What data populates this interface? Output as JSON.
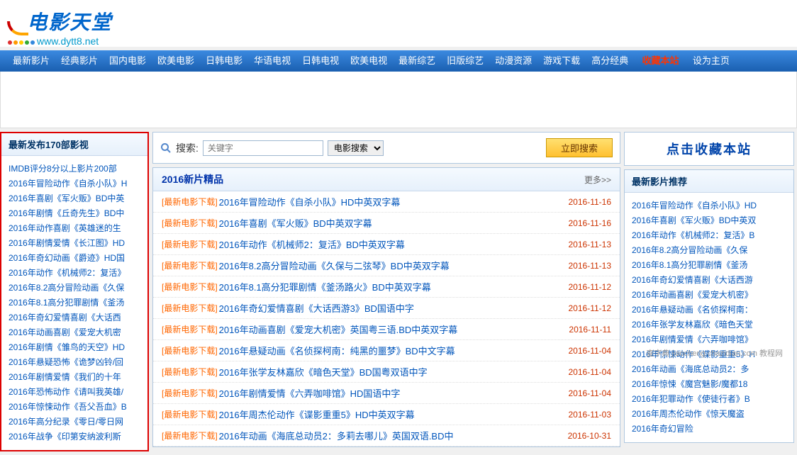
{
  "logo": {
    "text": "电影天堂",
    "url": "www.dytt8.net"
  },
  "nav": {
    "items": [
      "最新影片",
      "经典影片",
      "国内电影",
      "欧美电影",
      "日韩电影",
      "华语电视",
      "日韩电视",
      "欧美电视",
      "最新综艺",
      "旧版综艺",
      "动漫资源",
      "游戏下载",
      "高分经典"
    ],
    "highlight": "收藏本站",
    "tail": "设为主页"
  },
  "leftPanel": {
    "title": "最新发布170部影视",
    "items": [
      "IMDB评分8分以上影片200部",
      "2016年冒险动作《自杀小队》H",
      "2016年喜剧《军火贩》BD中英",
      "2016年剧情《丘奇先生》BD中",
      "2016年动作喜剧《英雄迷的生",
      "2016年剧情爱情《长江图》HD",
      "2016年奇幻动画《爵迹》HD国",
      "2016年动作《机械师2：复活》",
      "2016年8.2高分冒险动画《久保",
      "2016年8.1高分犯罪剧情《釜汤",
      "2016年奇幻爱情喜剧《大话西",
      "2016年动画喜剧《爱宠大机密",
      "2016年剧情《雏鸟的天空》HD",
      "2016年悬疑恐怖《诡梦凶铃/回",
      "2016年剧情爱情《我们的十年",
      "2016年恐怖动作《请叫我英雄/",
      "2016年惊悚动作《吾父吾血》B",
      "2016年高分纪录《零日/零日网",
      "2016年战争《印第安纳波利斯"
    ]
  },
  "search": {
    "label": "搜索:",
    "placeholder": "关键字",
    "value": "",
    "selectOption": "电影搜索",
    "button": "立即搜索"
  },
  "bookmark": {
    "text": "点击收藏本站"
  },
  "newPicks": {
    "title": "2016新片精品",
    "more": "更多>>",
    "tag": "[最新电影下载]",
    "items": [
      {
        "title": "2016年冒险动作《自杀小队》HD中英双字幕",
        "date": "2016-11-16"
      },
      {
        "title": "2016年喜剧《军火贩》BD中英双字幕",
        "date": "2016-11-16"
      },
      {
        "title": "2016年动作《机械师2：复活》BD中英双字幕",
        "date": "2016-11-13"
      },
      {
        "title": "2016年8.2高分冒险动画《久保与二弦琴》BD中英双字幕",
        "date": "2016-11-13"
      },
      {
        "title": "2016年8.1高分犯罪剧情《釜汤路火》BD中英双字幕",
        "date": "2016-11-12"
      },
      {
        "title": "2016年奇幻爱情喜剧《大话西游3》BD国语中字",
        "date": "2016-11-12"
      },
      {
        "title": "2016年动画喜剧《爱宠大机密》英国粤三语.BD中英双字幕",
        "date": "2016-11-11"
      },
      {
        "title": "2016年悬疑动画《名侦探柯南：纯黑的噩梦》BD中文字幕",
        "date": "2016-11-04"
      },
      {
        "title": "2016年张学友林嘉欣《暗色天堂》BD国粤双语中字",
        "date": "2016-11-04"
      },
      {
        "title": "2016年剧情爱情《六弄咖啡馆》HD国语中字",
        "date": "2016-11-04"
      },
      {
        "title": "2016年周杰伦动作《谍影重重5》HD中英双字幕",
        "date": "2016-11-03"
      },
      {
        "title": "2016年动画《海底总动员2：多莉去哪儿》英国双语.BD中",
        "date": "2016-10-31"
      }
    ]
  },
  "rightPanel": {
    "title": "最新影片推荐",
    "items": [
      "2016年冒险动作《自杀小队》HD",
      "2016年喜剧《军火贩》BD中英双",
      "2016年动作《机械师2：复活》B",
      "2016年8.2高分冒险动画《久保",
      "2016年8.1高分犯罪剧情《釜汤",
      "2016年奇幻爱情喜剧《大话西游",
      "2016年动画喜剧《爱宠大机密》",
      "2016年悬疑动画《名侦探柯南：",
      "2016年张学友林嘉欣《暗色天堂",
      "2016年剧情爱情《六弄咖啡馆》",
      "2016年惊悚动作《谍影重重5》H",
      "2016年动画《海底总动员2：多",
      "2016年惊悚《魔宫魅影/魔都18",
      "2016年犯罪动作《使徒行者》B",
      "2016年周杰伦动作《惊天魔盗",
      "2016年奇幻冒险"
    ]
  },
  "watermark": "查字典 jiaocheng.chazidian.com 教程网"
}
